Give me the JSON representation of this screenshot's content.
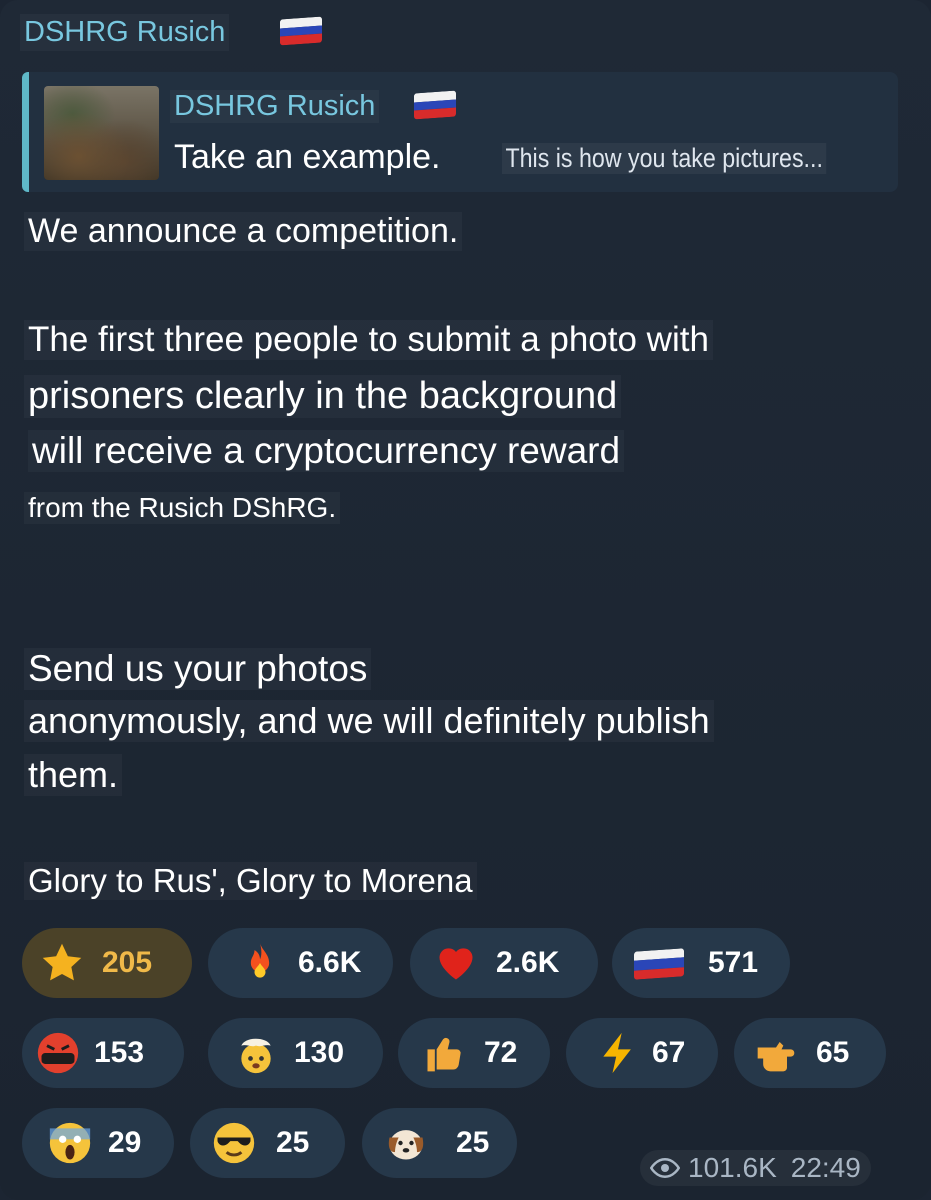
{
  "post": {
    "sender": "DSHRG Rusich",
    "reply": {
      "name": "DSHRG Rusich",
      "text": "Take an example.",
      "translation": "This is how you take pictures..."
    },
    "lines": [
      "We announce a competition.",
      "The first three people to submit a photo with",
      "prisoners clearly in the background",
      "will receive a cryptocurrency reward",
      "from the Rusich DShRG.",
      "Send us your photos",
      "anonymously, and we will definitely publish",
      "them.",
      "Glory to Rus', Glory to Morena"
    ],
    "views": "101.6K",
    "time": "22:49"
  },
  "reactions": [
    {
      "icon": "star-icon",
      "count": "205",
      "active": true
    },
    {
      "icon": "fire-icon",
      "count": "6.6K"
    },
    {
      "icon": "heart-icon",
      "count": "2.6K"
    },
    {
      "icon": "russian-flag-icon",
      "count": "571"
    },
    {
      "icon": "angry-face-icon",
      "count": "153"
    },
    {
      "icon": "exploding-head-icon",
      "count": "130"
    },
    {
      "icon": "thumbs-up-icon",
      "count": "72"
    },
    {
      "icon": "lightning-icon",
      "count": "67"
    },
    {
      "icon": "pointing-hand-icon",
      "count": "65"
    },
    {
      "icon": "screaming-face-icon",
      "count": "29"
    },
    {
      "icon": "sunglasses-face-icon",
      "count": "25"
    },
    {
      "icon": "dog-icon",
      "count": "25"
    }
  ],
  "colors": {
    "background": "#1c2532",
    "sender_name": "#78c7df",
    "chip": "#26384a",
    "chip_active": "#4b4228",
    "active_count": "#f0b949"
  }
}
